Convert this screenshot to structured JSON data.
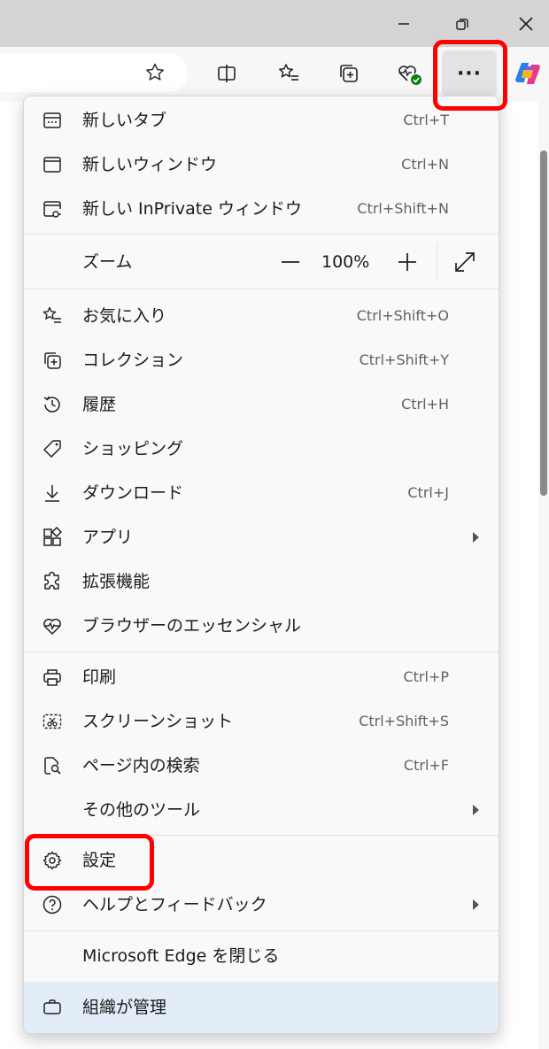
{
  "window": {
    "minimize_icon": "minimize-icon",
    "restore_icon": "restore-icon",
    "close_icon": "close-icon"
  },
  "toolbar": {
    "icons": [
      "favorite-star-icon",
      "split-screen-icon",
      "favorites-list-icon",
      "collections-icon",
      "browser-essentials-icon",
      "more-icon",
      "copilot-icon"
    ],
    "more_label": "···"
  },
  "menu": {
    "new_tab": {
      "label": "新しいタブ",
      "shortcut": "Ctrl+T"
    },
    "new_window": {
      "label": "新しいウィンドウ",
      "shortcut": "Ctrl+N"
    },
    "new_inprivate": {
      "label": "新しい InPrivate ウィンドウ",
      "shortcut": "Ctrl+Shift+N"
    },
    "zoom": {
      "label": "ズーム",
      "value": "100%",
      "minus": "−",
      "plus": "+"
    },
    "favorites": {
      "label": "お気に入り",
      "shortcut": "Ctrl+Shift+O"
    },
    "collections": {
      "label": "コレクション",
      "shortcut": "Ctrl+Shift+Y"
    },
    "history": {
      "label": "履歴",
      "shortcut": "Ctrl+H"
    },
    "shopping": {
      "label": "ショッピング"
    },
    "downloads": {
      "label": "ダウンロード",
      "shortcut": "Ctrl+J"
    },
    "apps": {
      "label": "アプリ"
    },
    "extensions": {
      "label": "拡張機能"
    },
    "essentials": {
      "label": "ブラウザーのエッセンシャル"
    },
    "print": {
      "label": "印刷",
      "shortcut": "Ctrl+P"
    },
    "screenshot": {
      "label": "スクリーンショット",
      "shortcut": "Ctrl+Shift+S"
    },
    "find": {
      "label": "ページ内の検索",
      "shortcut": "Ctrl+F"
    },
    "more_tools": {
      "label": "その他のツール"
    },
    "settings": {
      "label": "設定"
    },
    "help": {
      "label": "ヘルプとフィードバック"
    },
    "close_edge": {
      "label": "Microsoft Edge を閉じる"
    },
    "managed": {
      "label": "組織が管理"
    }
  },
  "colors": {
    "highlight": "#ff0000",
    "managed_bg": "#e2edf7",
    "status_green": "#107c10"
  }
}
